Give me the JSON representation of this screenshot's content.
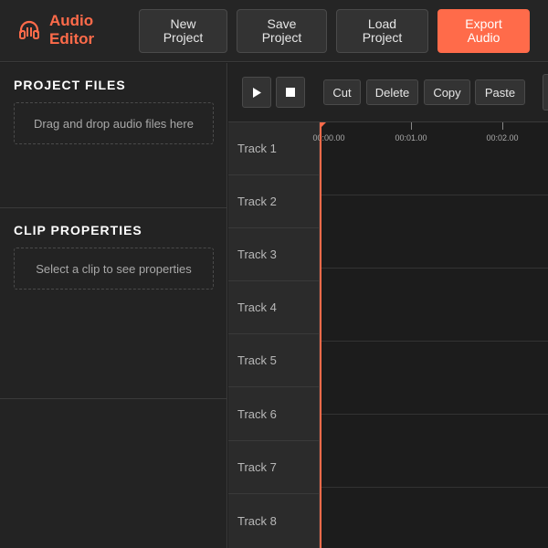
{
  "app": {
    "title": "Audio Editor",
    "accent_color": "#ff6b4a",
    "logo_icon": "headphones-icon"
  },
  "header": {
    "buttons": [
      {
        "id": "new",
        "label": "New Project"
      },
      {
        "id": "save",
        "label": "Save Project"
      },
      {
        "id": "load",
        "label": "Load Project"
      },
      {
        "id": "export",
        "label": "Export Audio"
      }
    ]
  },
  "sidebar": {
    "project_files": {
      "title": "PROJECT FILES",
      "dropzone_text": "Drag and drop audio files here"
    },
    "clip_properties": {
      "title": "CLIP PROPERTIES",
      "placeholder_text": "Select a clip to see properties"
    }
  },
  "toolbar": {
    "play_icon": "play-icon",
    "stop_icon": "stop-icon",
    "cut_label": "Cut",
    "delete_label": "Delete",
    "copy_label": "Copy",
    "paste_label": "Paste"
  },
  "timeline": {
    "ticks": [
      "00:00.00",
      "00:01.00",
      "00:02.00"
    ],
    "tracks": [
      "Track 1",
      "Track 2",
      "Track 3",
      "Track 4",
      "Track 5",
      "Track 6",
      "Track 7",
      "Track 8"
    ]
  }
}
